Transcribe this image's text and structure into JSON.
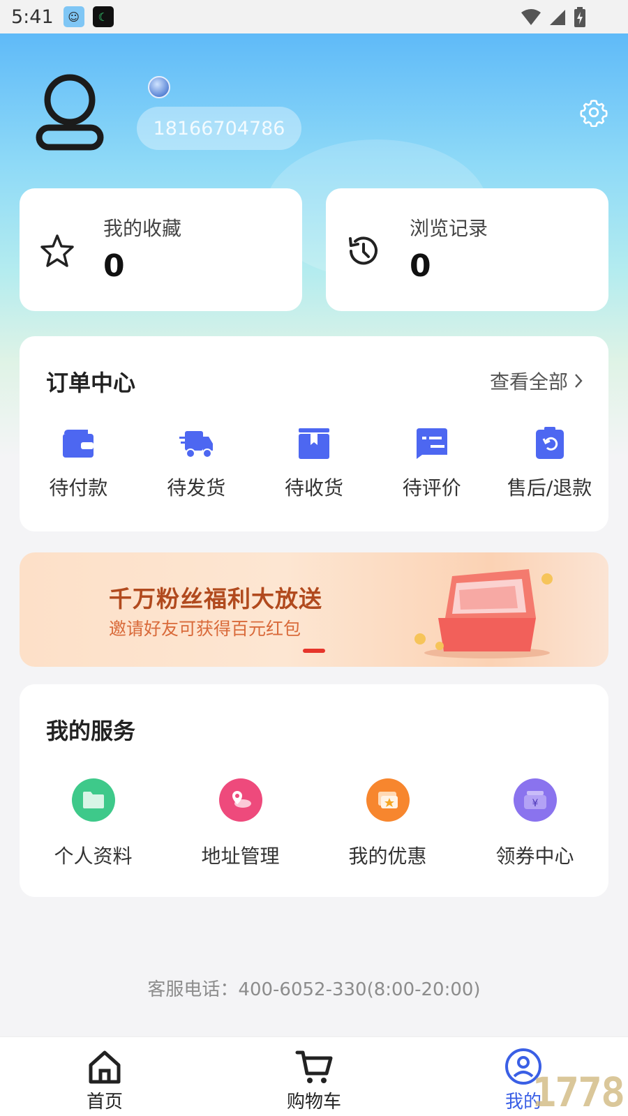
{
  "status_bar": {
    "time": "5:41"
  },
  "profile": {
    "phone": "18166704786"
  },
  "stats": {
    "favorites": {
      "label": "我的收藏",
      "value": "0"
    },
    "history": {
      "label": "浏览记录",
      "value": "0"
    }
  },
  "orders": {
    "title": "订单中心",
    "view_all": "查看全部",
    "items": [
      {
        "label": "待付款",
        "icon": "wallet-icon"
      },
      {
        "label": "待发货",
        "icon": "truck-icon"
      },
      {
        "label": "待收货",
        "icon": "package-icon"
      },
      {
        "label": "待评价",
        "icon": "comment-icon"
      },
      {
        "label": "售后/退款",
        "icon": "refund-icon"
      }
    ],
    "accent": "#4d67f1"
  },
  "banner": {
    "title": "千万粉丝福利大放送",
    "subtitle": "邀请好友可获得百元红包"
  },
  "services": {
    "title": "我的服务",
    "items": [
      {
        "label": "个人资料",
        "icon": "folder-icon",
        "color": "#3ec98a"
      },
      {
        "label": "地址管理",
        "icon": "map-pin-icon",
        "color": "#ee4a7c"
      },
      {
        "label": "我的优惠",
        "icon": "ticket-icon",
        "color": "#f7862e"
      },
      {
        "label": "领券中心",
        "icon": "coupon-icon",
        "color": "#8a73ee"
      }
    ]
  },
  "footer": {
    "hotline": "客服电话：400-6052-330(8:00-20:00)"
  },
  "nav": {
    "items": [
      {
        "label": "首页",
        "icon": "home-icon"
      },
      {
        "label": "购物车",
        "icon": "cart-icon"
      },
      {
        "label": "我的",
        "icon": "user-icon",
        "active": true
      }
    ],
    "active_color": "#3a5fe5"
  },
  "watermark": "1778"
}
